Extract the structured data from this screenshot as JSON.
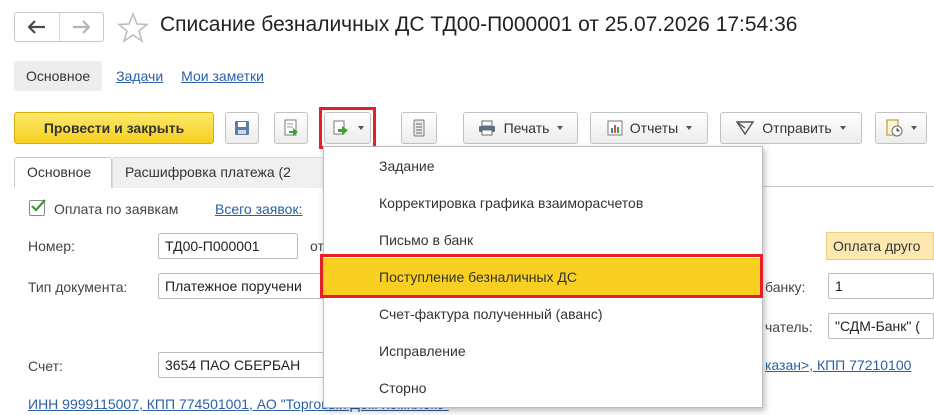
{
  "header": {
    "title": "Списание безналичных ДС ТД00-П000001 от 25.07.2026 17:54:36",
    "back_icon": "arrow-left-icon",
    "forward_icon": "arrow-right-icon",
    "favorite_icon": "star-icon"
  },
  "sections": {
    "active": "Основное",
    "links": [
      "Задачи",
      "Мои заметки"
    ]
  },
  "toolbar": {
    "post_close_label": "Провести и закрыть",
    "print_label": "Печать",
    "reports_label": "Отчеты",
    "send_label": "Отправить",
    "accent_color": "#f5cf20"
  },
  "tabs": [
    "Основное",
    "Расшифровка платежа (2"
  ],
  "form": {
    "pay_by_requests_label": "Оплата по заявкам",
    "pay_by_requests_checked": true,
    "all_requests_link": "Всего заявок:",
    "number_label": "Номер:",
    "number_value": "ТД00-П000001",
    "from_label_partial": "от",
    "status_badge": "Оплата друго",
    "doc_type_label": "Тип документа:",
    "doc_type_value": "Платежное поручени",
    "bank_label_partial": "банку:",
    "bank_value": "1",
    "recipient_label_partial": "чатель:",
    "recipient_value": "\"СДМ-Банк\" (",
    "account_label": "Счет:",
    "account_value": "3654 ПАО СБЕРБАН",
    "link_right": "казан>, КПП 77210100",
    "link_bottom": "ИНН 9999115007, КПП 774501001, АО \"Торговый Дом Комплекс\""
  },
  "menu": {
    "items": [
      "Задание",
      "Корректировка графика взаиморасчетов",
      "Письмо в банк",
      "Поступление безналичных ДС",
      "Счет-фактура полученный (аванс)",
      "Исправление",
      "Сторно"
    ],
    "selected_index": 3,
    "highlight_color": "#f9cf22",
    "frame_color": "#e3202a"
  }
}
